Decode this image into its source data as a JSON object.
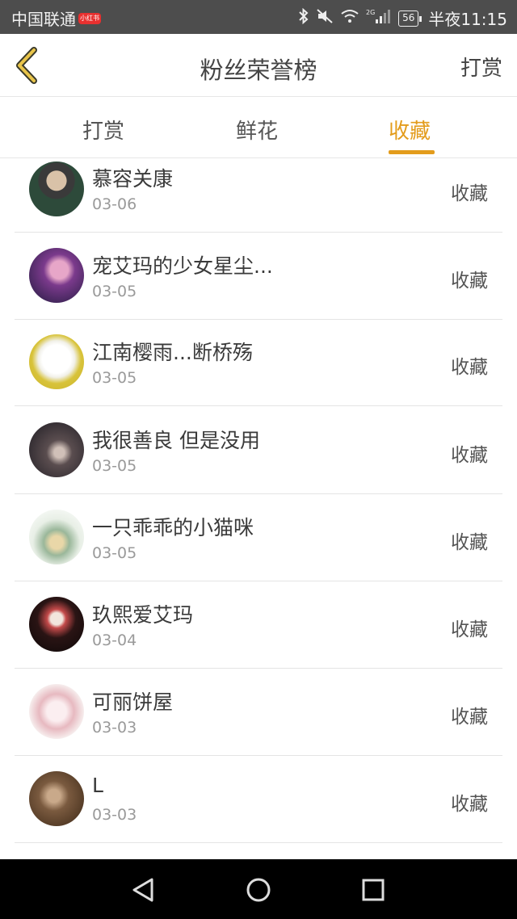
{
  "status_bar": {
    "carrier": "中国联通",
    "carrier_badge": "小红书",
    "network": "2G",
    "battery": "56",
    "time": "半夜11:15"
  },
  "header": {
    "title": "粉丝荣誉榜",
    "action": "打赏"
  },
  "tabs": [
    {
      "label": "打赏",
      "active": false
    },
    {
      "label": "鲜花",
      "active": false
    },
    {
      "label": "收藏",
      "active": true
    }
  ],
  "colors": {
    "accent": "#e39c1c",
    "status_bar": "#4d4d4d",
    "navbar": "#000000"
  },
  "items": [
    {
      "name": "慕容关康",
      "date": "03-06",
      "action": "收藏"
    },
    {
      "name": "宠艾玛的少女星尘...",
      "date": "03-05",
      "action": "收藏"
    },
    {
      "name": "江南樱雨...断桥殇",
      "date": "03-05",
      "action": "收藏"
    },
    {
      "name": "我很善良 但是没用",
      "date": "03-05",
      "action": "收藏"
    },
    {
      "name": "一只乖乖的小猫咪",
      "date": "03-05",
      "action": "收藏"
    },
    {
      "name": "玖熙爱艾玛",
      "date": "03-04",
      "action": "收藏"
    },
    {
      "name": "可丽饼屋",
      "date": "03-03",
      "action": "收藏"
    },
    {
      "name": "L",
      "date": "03-03",
      "action": "收藏"
    }
  ],
  "navbar": {
    "icons": [
      "back-triangle-icon",
      "home-circle-icon",
      "recents-square-icon"
    ]
  }
}
